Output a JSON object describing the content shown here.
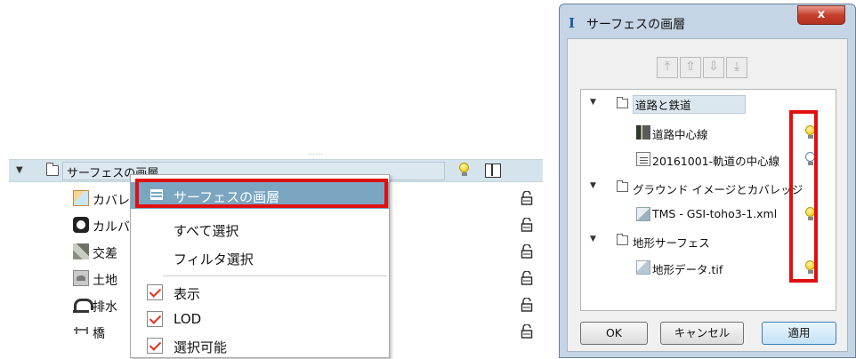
{
  "tree": {
    "header_label": "サーフェスの画層",
    "grip": "……",
    "items": [
      {
        "label": "カバレ",
        "icon": "coverage-icon"
      },
      {
        "label": "カルバ",
        "icon": "culvert-icon"
      },
      {
        "label": "交差",
        "icon": "intersection-icon"
      },
      {
        "label": "土地",
        "icon": "land-icon"
      },
      {
        "label": "排水",
        "icon": "drainage-icon"
      },
      {
        "label": "橋",
        "icon": "bridge-icon"
      }
    ]
  },
  "context_menu": {
    "items": [
      {
        "label": "サーフェスの画層",
        "highlighted": true
      },
      {
        "label": "すべて選択"
      },
      {
        "label": "フィルタ選択"
      },
      {
        "label": "表示",
        "checked": true
      },
      {
        "label": "LOD",
        "checked": true
      },
      {
        "label": "選択可能",
        "checked": true
      }
    ]
  },
  "dialog": {
    "title_icon": "I",
    "title": "サーフェスの画層",
    "close_label": "x",
    "toolbar": [
      "move-top-icon",
      "move-up-icon",
      "move-down-icon",
      "move-bottom-icon"
    ],
    "layers": {
      "road_group": "道路と鉄道",
      "road_centerline": "道路中心線",
      "rail_centerline": "20161001-軌道の中心線",
      "ground_group": "グラウンド イメージとカバレッジ",
      "tms_layer": "TMS - GSI-toho3-1.xml",
      "terrain_group": "地形サーフェス",
      "terrain_layer": "地形データ.tif"
    },
    "buttons": {
      "ok": "OK",
      "cancel": "キャンセル",
      "apply": "適用"
    }
  },
  "colors": {
    "highlight_border": "#e01010",
    "menu_selection": "#7aa6c2",
    "check_mark": "#e0321e",
    "bulb_on": "#f2d12a"
  }
}
